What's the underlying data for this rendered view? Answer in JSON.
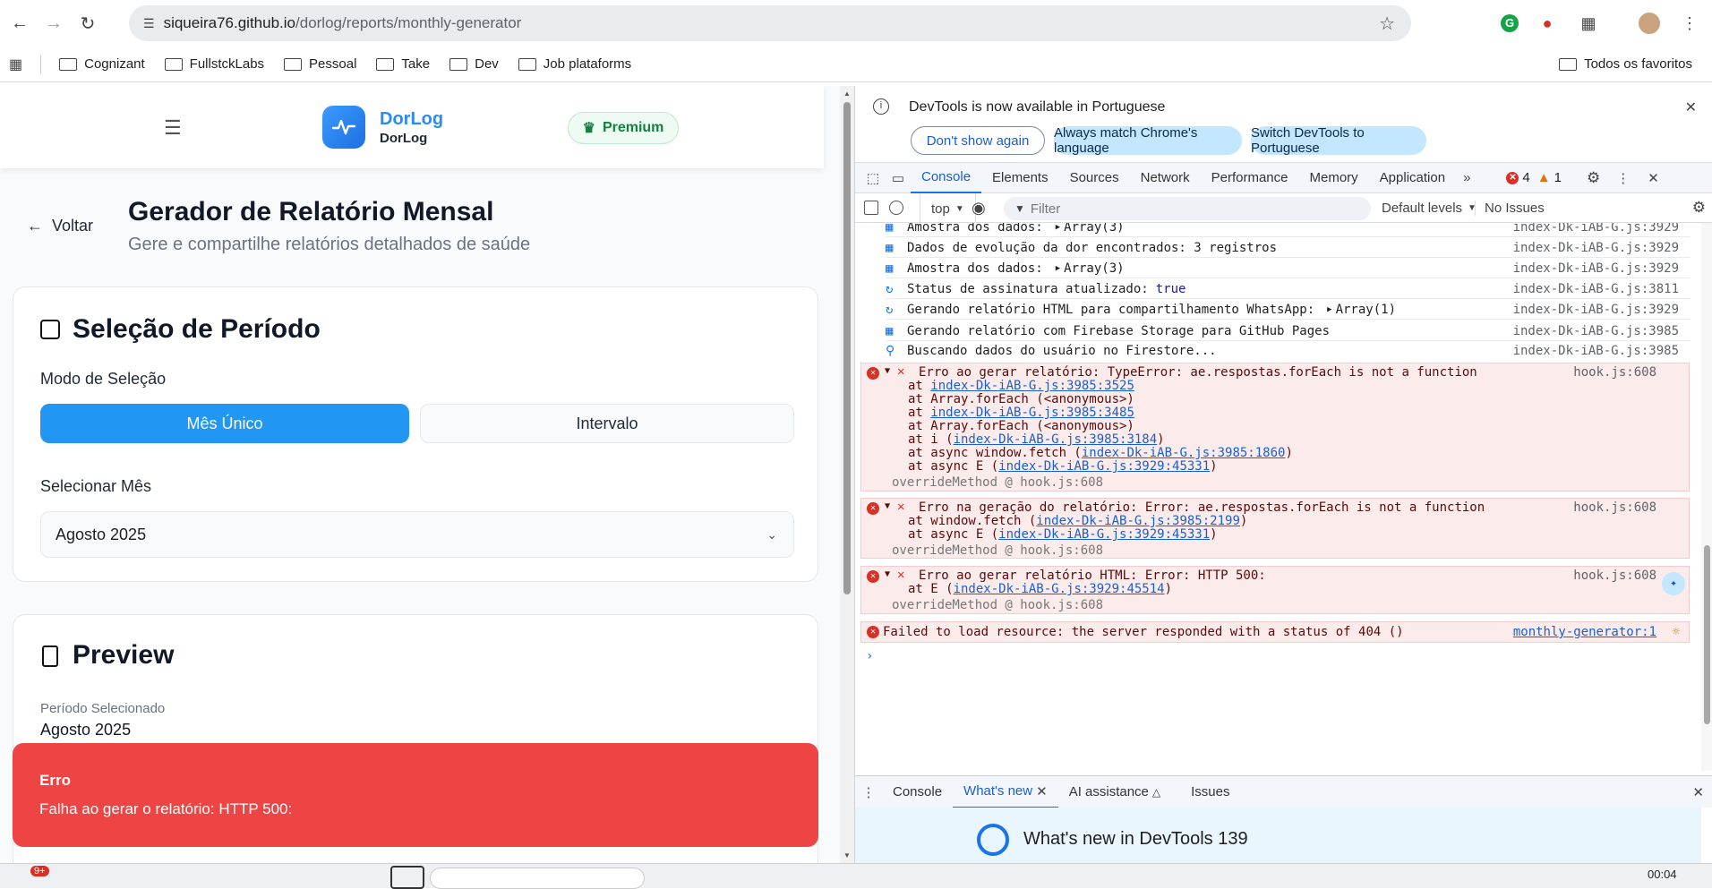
{
  "browser": {
    "url_host": "siqueira76.github.io",
    "url_path": "/dorlog/reports/monthly-generator",
    "bookmarks": [
      "Cognizant",
      "FullstckLabs",
      "Pessoal",
      "Take",
      "Dev",
      "Job plataforms"
    ],
    "all_bookmarks_label": "Todos os favoritos"
  },
  "app": {
    "brand_title": "DorLog",
    "brand_subtitle": "DorLog",
    "premium_label": "Premium",
    "back_label": "Voltar",
    "page_title": "Gerador de Relatório Mensal",
    "page_subtitle": "Gere e compartilhe relatórios detalhados de saúde",
    "period_card": {
      "title": "Seleção de Período",
      "mode_label": "Modo de Seleção",
      "mode_single": "Mês Único",
      "mode_range": "Intervalo",
      "select_month_label": "Selecionar Mês",
      "selected_month": "Agosto 2025"
    },
    "preview_card": {
      "title": "Preview",
      "period_label": "Período Selecionado",
      "period_value": "Agosto 2025"
    },
    "toast": {
      "title": "Erro",
      "message": "Falha ao gerar o relatório: HTTP 500:"
    },
    "colors": {
      "primary": "#2196f3",
      "error": "#ef4444",
      "premium": "#15803d"
    }
  },
  "devtools": {
    "infobar": {
      "message": "DevTools is now available in Portuguese",
      "btn_dismiss": "Don't show again",
      "btn_match": "Always match Chrome's language",
      "btn_switch": "Switch DevTools to Portuguese"
    },
    "tabs": [
      "Console",
      "Elements",
      "Sources",
      "Network",
      "Performance",
      "Memory",
      "Application"
    ],
    "error_count": "4",
    "warning_count": "1",
    "filter": {
      "context": "top",
      "placeholder": "Filter",
      "levels": "Default levels",
      "issues": "No Issues"
    },
    "logs": [
      {
        "icon": "chart-icon",
        "text": "Amostra dos dados:",
        "obj": "Array(3)",
        "src": "index-Dk-iAB-G.js:3929"
      },
      {
        "icon": "chart-icon",
        "text": "Dados de evolução da dor encontrados: 3 registros",
        "obj": "",
        "src": "index-Dk-iAB-G.js:3929"
      },
      {
        "icon": "chart-icon",
        "text": "Amostra dos dados:",
        "obj": "Array(3)",
        "src": "index-Dk-iAB-G.js:3929"
      },
      {
        "icon": "refresh-icon",
        "text": "Status de assinatura atualizado:",
        "obj": "true",
        "src": "index-Dk-iAB-G.js:3811"
      },
      {
        "icon": "refresh-icon",
        "text": "Gerando relatório HTML para compartilhamento WhatsApp:",
        "obj": "Array(1)",
        "src": "index-Dk-iAB-G.js:3929"
      },
      {
        "icon": "chart-icon",
        "text": "Gerando relatório com Firebase Storage para GitHub Pages",
        "obj": "",
        "src": "index-Dk-iAB-G.js:3985"
      },
      {
        "icon": "magnifier-icon",
        "text": "Buscando dados do usuário no Firestore...",
        "obj": "",
        "src": "index-Dk-iAB-G.js:3985"
      }
    ],
    "errors": [
      {
        "head": "Erro ao gerar relatório: TypeError: ae.respostas.forEach is not a function",
        "src": "hook.js:608",
        "stack": [
          [
            "at ",
            "index-Dk-iAB-G.js:3985:3525",
            ""
          ],
          [
            "at Array.forEach (<anonymous>)",
            "",
            ""
          ],
          [
            "at ",
            "index-Dk-iAB-G.js:3985:3485",
            ""
          ],
          [
            "at Array.forEach (<anonymous>)",
            "",
            ""
          ],
          [
            "at i (",
            "index-Dk-iAB-G.js:3985:3184",
            ")"
          ],
          [
            "at async window.fetch (",
            "index-Dk-iAB-G.js:3985:1860",
            ")"
          ],
          [
            "at async E (",
            "index-Dk-iAB-G.js:3929:45331",
            ")"
          ]
        ],
        "override": "overrideMethod @ hook.js:608"
      },
      {
        "head": "Erro na geração do relatório: Error: ae.respostas.forEach is not a function",
        "src": "hook.js:608",
        "stack": [
          [
            "at window.fetch (",
            "index-Dk-iAB-G.js:3985:2199",
            ")"
          ],
          [
            "at async E (",
            "index-Dk-iAB-G.js:3929:45331",
            ")"
          ]
        ],
        "override": "overrideMethod @ hook.js:608"
      },
      {
        "head": "Erro ao gerar relatório HTML: Error: HTTP 500:",
        "src": "hook.js:608",
        "stack": [
          [
            "at E (",
            "index-Dk-iAB-G.js:3929:45514",
            ")"
          ]
        ],
        "override": "overrideMethod @ hook.js:608"
      }
    ],
    "failed_resource": {
      "text": "Failed to load resource: the server responded with a status of 404 ()",
      "src": "monthly-generator:1"
    },
    "drawer_tabs": [
      "Console",
      "What's new",
      "AI assistance",
      "Issues"
    ],
    "whats_new_title": "What's new in DevTools 139"
  },
  "taskbar": {
    "notification_badge": "9+",
    "clock": "00:04"
  }
}
